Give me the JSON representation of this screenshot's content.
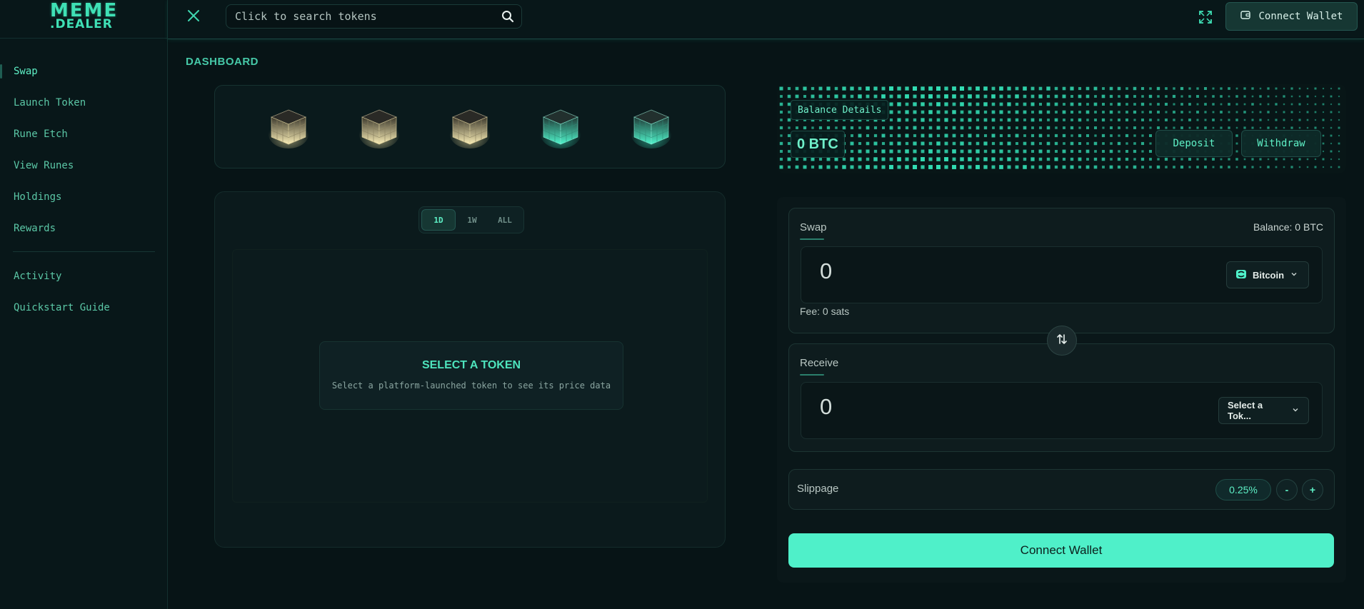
{
  "brand": {
    "logo_line1": "MEME",
    "logo_line2": ".DEALER"
  },
  "sidebar": {
    "items": [
      {
        "label": "Swap",
        "active": true
      },
      {
        "label": "Launch Token"
      },
      {
        "label": "Rune Etch"
      },
      {
        "label": "View Runes"
      },
      {
        "label": "Holdings"
      },
      {
        "label": "Rewards"
      }
    ],
    "secondary": [
      {
        "label": "Activity"
      },
      {
        "label": "Quickstart Guide"
      }
    ]
  },
  "topbar": {
    "search_placeholder": "Click to search tokens",
    "connect_label": "Connect Wallet",
    "icons": [
      "close-icon",
      "search-icon",
      "expand-icon",
      "wallet-icon"
    ]
  },
  "dashboard": {
    "title": "DASHBOARD",
    "cubes": [
      {
        "tone": "gold"
      },
      {
        "tone": "gold"
      },
      {
        "tone": "gold"
      },
      {
        "tone": "teal"
      },
      {
        "tone": "teal"
      }
    ],
    "range_tabs": [
      "1D",
      "1W",
      "ALL"
    ],
    "active_range": "1D",
    "empty_state": {
      "title": "SELECT A TOKEN",
      "message": "Select a platform-launched token to see its price data"
    }
  },
  "balance": {
    "label": "Balance Details",
    "value": "0 BTC",
    "deposit_label": "Deposit",
    "withdraw_label": "Withdraw"
  },
  "swap": {
    "title": "Swap",
    "balance_text": "Balance: 0  BTC",
    "amount": "0",
    "token": "Bitcoin",
    "fee_text": "Fee: 0 sats"
  },
  "receive": {
    "title": "Receive",
    "amount": "0",
    "token_placeholder": "Select a Tok..."
  },
  "slippage": {
    "label": "Slippage",
    "value": "0.25%",
    "minus_label": "-",
    "plus_label": "+"
  },
  "connect_button_label": "Connect Wallet",
  "colors": {
    "accent": "#4ff0c9",
    "background": "#071416",
    "gold_cube": "#f4e3a0",
    "teal_cube": "#3fe8c0"
  }
}
